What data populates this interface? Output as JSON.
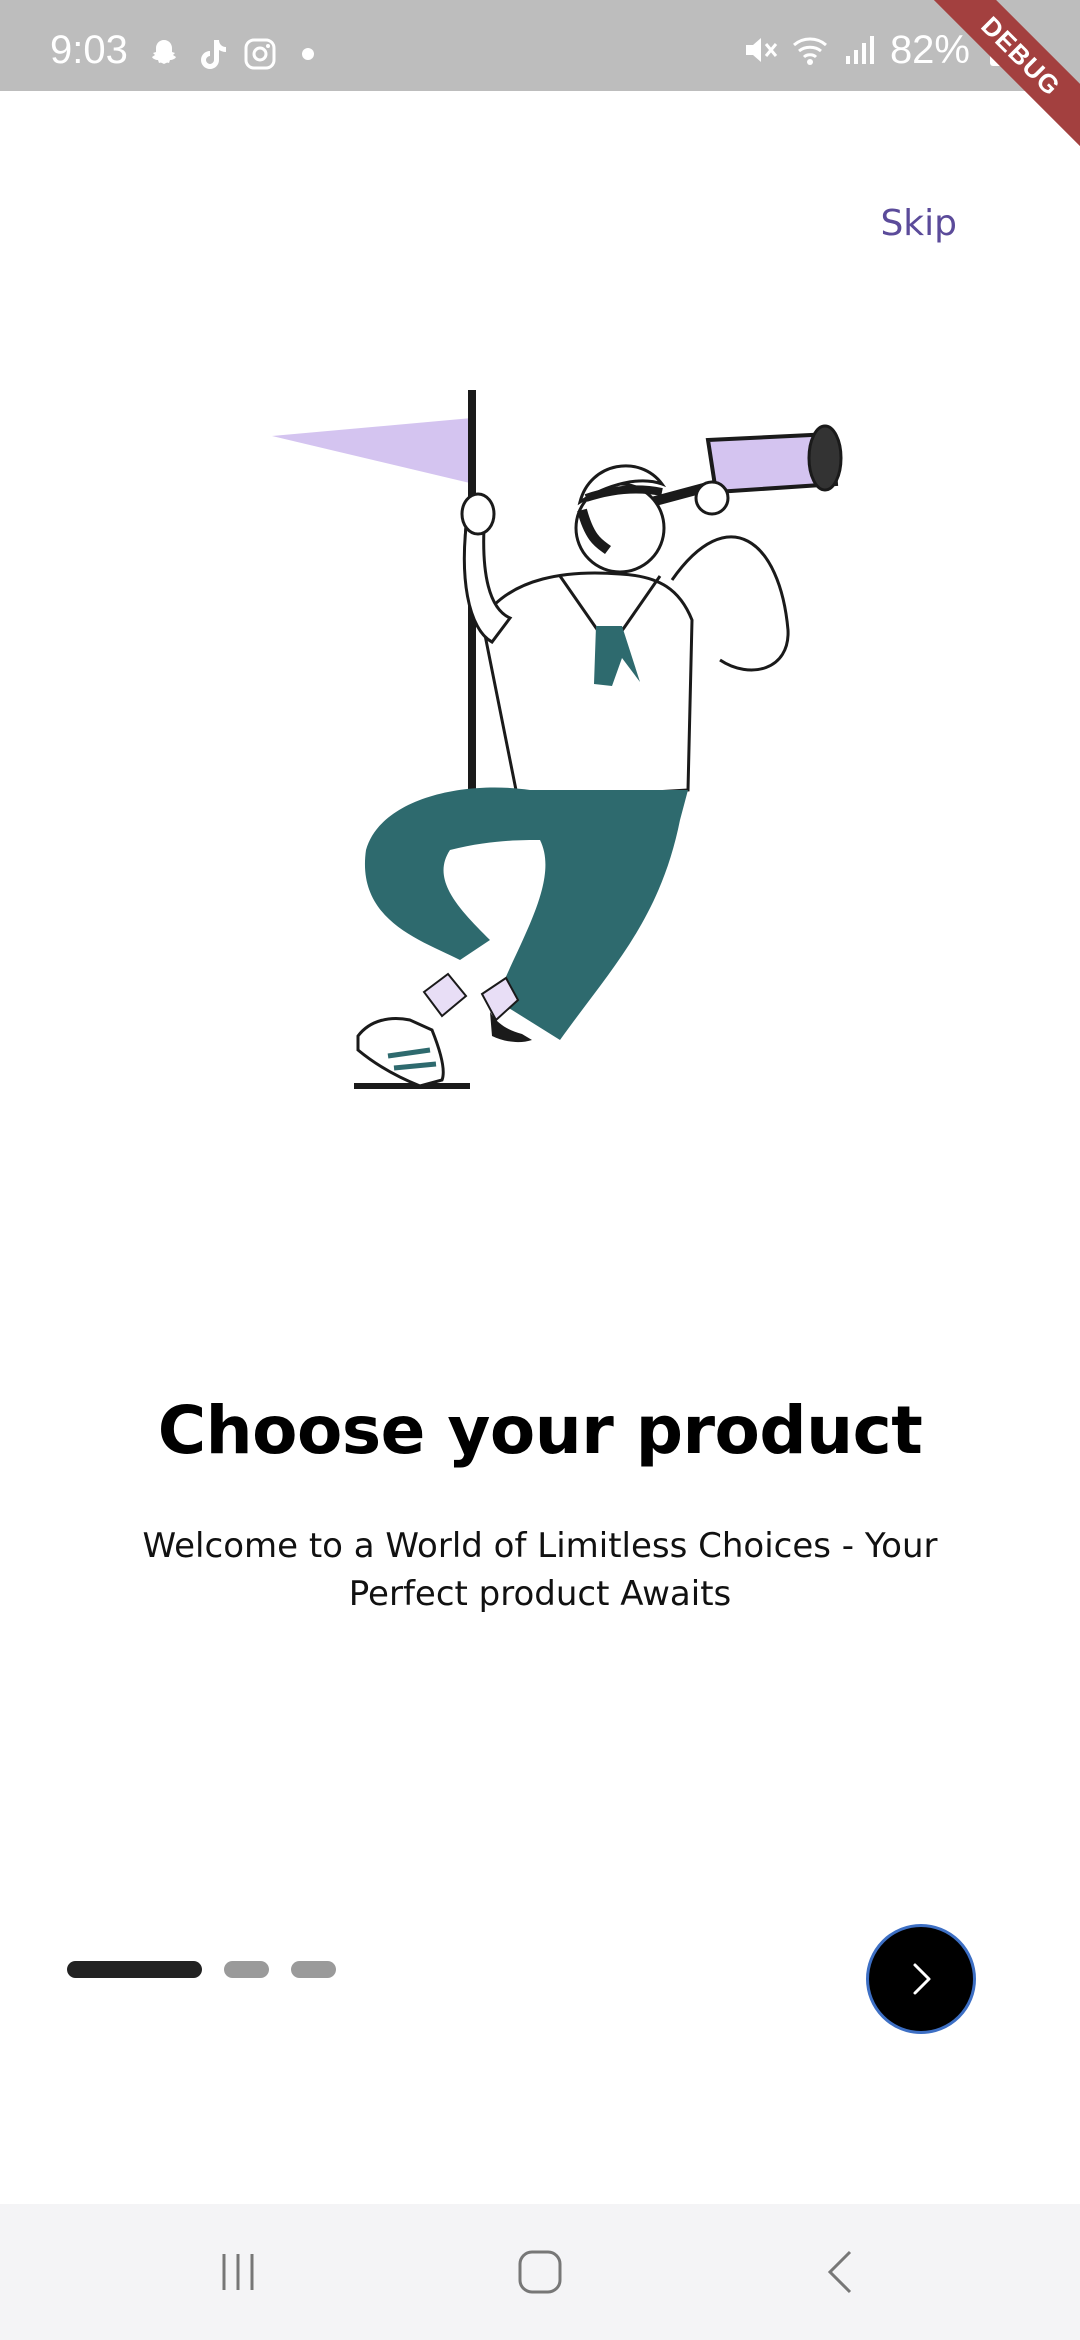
{
  "status_bar": {
    "time": "9:03",
    "battery": "82%",
    "left_icons": [
      "snapchat-icon",
      "tiktok-icon",
      "instagram-icon",
      "dot-icon"
    ],
    "right_icons": [
      "mute-icon",
      "wifi-icon",
      "signal-icon",
      "battery-icon"
    ],
    "debug_label": "DEBUG"
  },
  "onboarding": {
    "skip_label": "Skip",
    "title": "Choose your product",
    "subtitle": "Welcome to a World of Limitless Choices - Your Perfect product Awaits",
    "page_indicator": {
      "current": 1,
      "total": 3
    },
    "next_icon": "chevron-right-icon"
  },
  "colors": {
    "accent_purple": "#5b4b9a",
    "illustration_lilac": "#d4c4f0",
    "illustration_teal": "#2e6a6e",
    "button_bg": "#000000",
    "button_border": "#3d6fc4"
  },
  "nav_bar": {
    "icons": [
      "recent-apps-icon",
      "home-icon",
      "back-icon"
    ]
  }
}
